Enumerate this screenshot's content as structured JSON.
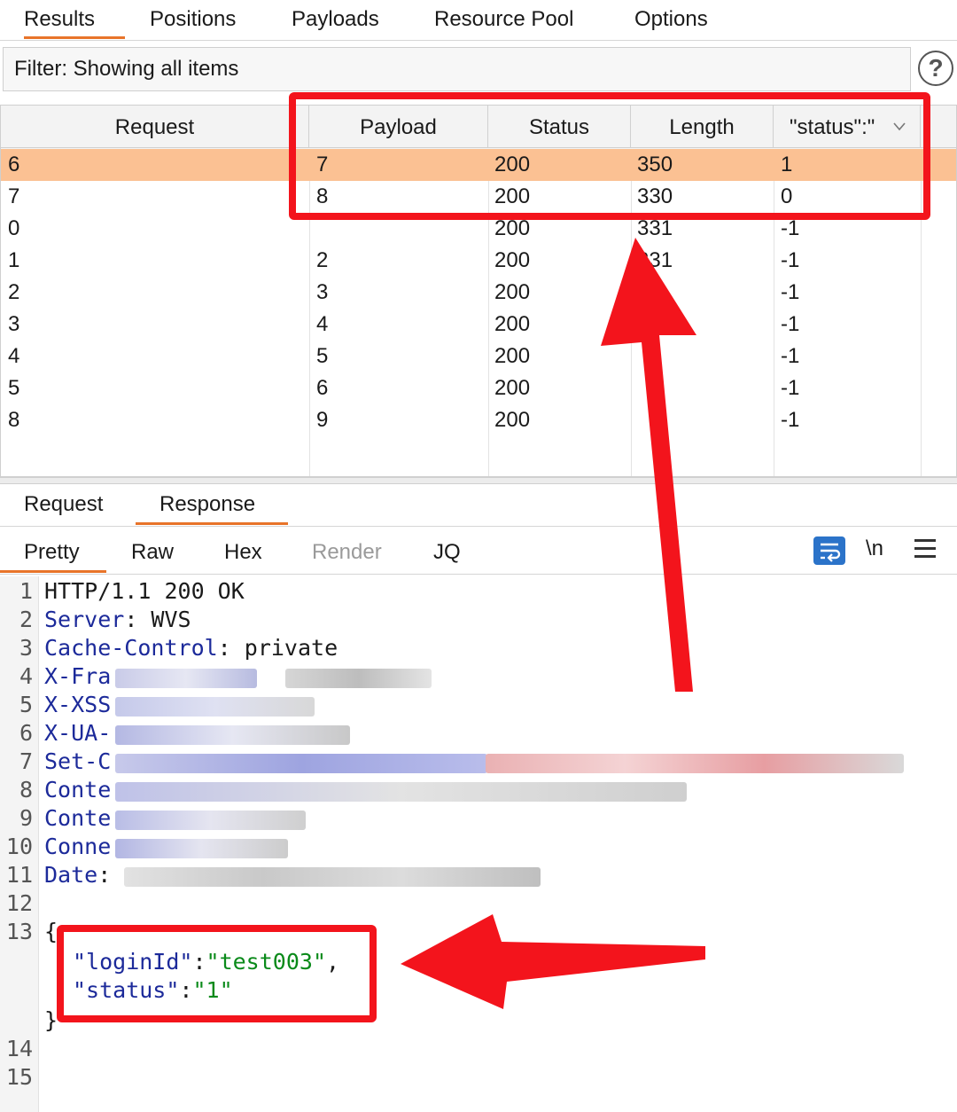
{
  "top_tabs": [
    "Results",
    "Positions",
    "Payloads",
    "Resource Pool",
    "Options"
  ],
  "filter": {
    "text": "Filter: Showing all items",
    "help": "?"
  },
  "table": {
    "headers": [
      "Request",
      "Payload",
      "Status",
      "Length",
      "\"status\":\""
    ],
    "rows": [
      {
        "request": "6",
        "payload": "7",
        "status": "200",
        "length": "350",
        "extract": "1"
      },
      {
        "request": "7",
        "payload": "8",
        "status": "200",
        "length": "330",
        "extract": "0"
      },
      {
        "request": "0",
        "payload": "",
        "status": "200",
        "length": "331",
        "extract": "-1"
      },
      {
        "request": "1",
        "payload": "2",
        "status": "200",
        "length": "331",
        "extract": "-1"
      },
      {
        "request": "2",
        "payload": "3",
        "status": "200",
        "length": "",
        "extract": "-1"
      },
      {
        "request": "3",
        "payload": "4",
        "status": "200",
        "length": "",
        "extract": "-1"
      },
      {
        "request": "4",
        "payload": "5",
        "status": "200",
        "length": "",
        "extract": "-1"
      },
      {
        "request": "5",
        "payload": "6",
        "status": "200",
        "length": "",
        "extract": "-1"
      },
      {
        "request": "8",
        "payload": "9",
        "status": "200",
        "length": "",
        "extract": "-1"
      }
    ]
  },
  "rr_tabs": [
    "Request",
    "Response"
  ],
  "view_tabs": [
    "Pretty",
    "Raw",
    "Hex",
    "Render",
    "JQ"
  ],
  "view_toolbar": {
    "newline": "\\n"
  },
  "code": {
    "line_numbers": [
      "1",
      "2",
      "3",
      "4",
      "5",
      "6",
      "7",
      "8",
      "9",
      "10",
      "11",
      "12",
      "13",
      "",
      "",
      "",
      "14",
      "15"
    ],
    "l1": "HTTP/1.1 200 OK",
    "l2_key": "Server",
    "l2_val": ": WVS",
    "l3_key": "Cache-Control",
    "l3_val": ": private",
    "l4_key": "X-Fra",
    "l5_key": "X-XSS",
    "l6_key": "X-UA-",
    "l7_key": "Set-C",
    "l8_key": "Conte",
    "l9_key": "Conte",
    "l10_key": "Conne",
    "l11_key": "Date",
    "l11_colon": ":",
    "open_brace": "{",
    "json_key1": "\"loginId\"",
    "json_colon1": ":",
    "json_val1": "\"test003\"",
    "json_comma": ",",
    "json_key2": "\"status\"",
    "json_colon2": ":",
    "json_val2": "\"1\"",
    "close_brace": "}"
  }
}
